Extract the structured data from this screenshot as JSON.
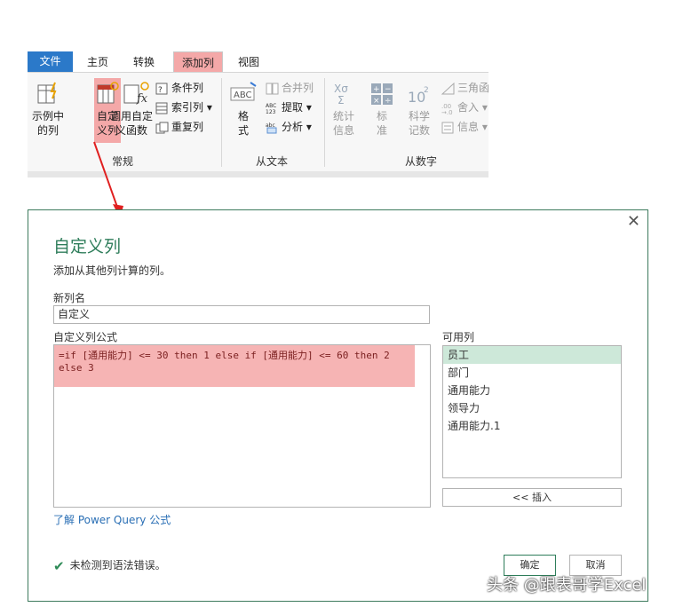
{
  "ribbon": {
    "tabs": [
      {
        "label": "文件"
      },
      {
        "label": "主页"
      },
      {
        "label": "转换"
      },
      {
        "label": "添加列"
      },
      {
        "label": "视图"
      }
    ],
    "buttons": {
      "example_col": "示例中的列",
      "custom_col": "自定义列",
      "invoke_fn": "调用自定义函数",
      "cond_col": "条件列",
      "index_col": "索引列",
      "dup_col": "重复列",
      "format": "格式",
      "merge_col": "合并列",
      "extract": "提取",
      "parse": "分析",
      "stats": "统计信息",
      "standard": "标准",
      "scientific": "科学记数",
      "trig": "三角函",
      "round": "舍入",
      "info": "信息"
    },
    "groups": {
      "general": "常规",
      "from_text": "从文本",
      "from_number": "从数字"
    }
  },
  "dialog": {
    "title": "自定义列",
    "subtitle": "添加从其他列计算的列。",
    "new_col_label": "新列名",
    "new_col_value": "自定义",
    "formula_label": "自定义列公式",
    "formula": "=if [通用能力] <= 30 then 1 else if [通用能力] <= 60 then 2 else 3",
    "available_label": "可用列",
    "available_columns": [
      "员工",
      "部门",
      "通用能力",
      "领导力",
      "通用能力.1"
    ],
    "insert_label": "<< 插入",
    "learn_link": "了解 Power Query 公式",
    "status": "未检测到语法错误。",
    "ok_label": "确定",
    "cancel_label": "取消"
  },
  "watermark": "头条 @跟表哥学Excel",
  "colors": {
    "file_tab": "#2b79c9",
    "highlight": "#f4a8a8",
    "dialog_accent": "#2e7d5a",
    "arrow": "#e02020"
  }
}
